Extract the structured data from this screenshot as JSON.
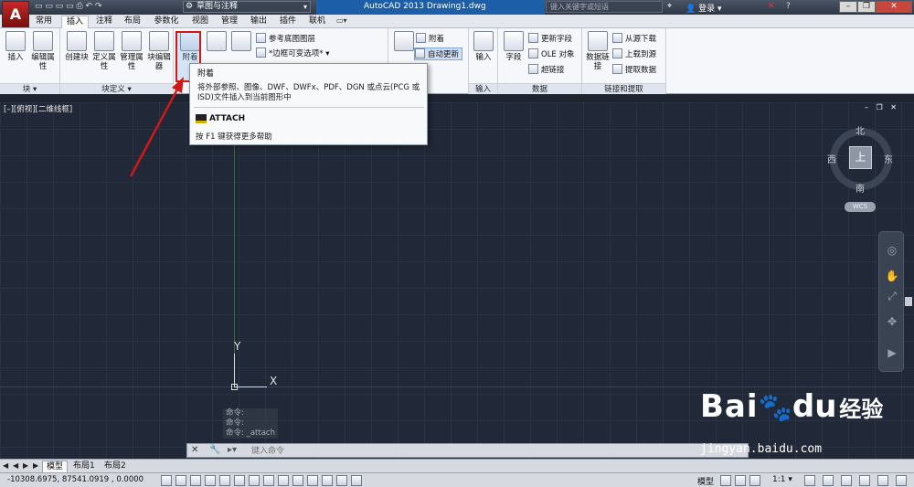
{
  "titlebar": {
    "logo": "A",
    "workspace": "草图与注释",
    "title": "AutoCAD 2013    Drawing1.dwg",
    "search_placeholder": "键入关键字或短语",
    "login": "登录",
    "minimize": "–",
    "restore": "❐",
    "close": "✕"
  },
  "tabs": [
    "常用",
    "插入",
    "注释",
    "布局",
    "参数化",
    "视图",
    "管理",
    "输出",
    "插件",
    "联机"
  ],
  "active_tab": "插入",
  "ribbon": {
    "block": {
      "title": "块 ▾",
      "insert": "插入",
      "edit_attr": "编辑属性"
    },
    "block_def": {
      "title": "块定义 ▾",
      "create": "创建块",
      "define_attr": "定义属性",
      "manage_attr": "管理属性",
      "block_editor": "块编辑器"
    },
    "reference": {
      "attach": "附着",
      "ref_layers": "参考底图图层",
      "frame_variable": "*边框可变选项*"
    },
    "pointcloud": {
      "attach": "附着",
      "auto_update": "自动更新"
    },
    "import": {
      "title": "输入",
      "import_btn": "输入"
    },
    "data": {
      "title": "数据",
      "field": "字段",
      "update_field": "更新字段",
      "ole": "OLE 对象",
      "hyperlink": "超链接"
    },
    "link": {
      "title": "链接和提取",
      "data_link": "数据链接",
      "download_source": "从源下载",
      "upload_source": "上载到源",
      "extract_data": "提取数据"
    }
  },
  "tooltip": {
    "title": "附着",
    "description": "将外部参照、图像、DWF、DWFx、PDF、DGN 或点云(PCG 或 ISD)文件插入到当前图形中",
    "command": "ATTACH",
    "help": "按 F1 键获得更多帮助"
  },
  "viewport": {
    "label": "[–][俯视][二维线框]",
    "controls": "– ❐ ✕"
  },
  "viewcube": {
    "top": "上",
    "north": "北",
    "south": "南",
    "east": "东",
    "west": "西",
    "wcs": "WCS"
  },
  "ucs": {
    "x": "X",
    "y": "Y"
  },
  "command": {
    "history": [
      "命令:",
      "命令:",
      "命令: _attach"
    ],
    "placeholder": "键入命令"
  },
  "layout_tabs": [
    "模型",
    "布局1",
    "布局2"
  ],
  "status": {
    "coords": "-10308.6975, 87541.0919 , 0.0000",
    "model": "模型",
    "scale": "1:1 ▾"
  },
  "watermark": {
    "brand": "Bai",
    "brand2": "du",
    "jingyan": "经验",
    "url": "jingyan.baidu.com"
  },
  "colors": {
    "highlight": "#d01818",
    "title_accent": "#1c5fa8",
    "viewport_bg": "#212837"
  }
}
